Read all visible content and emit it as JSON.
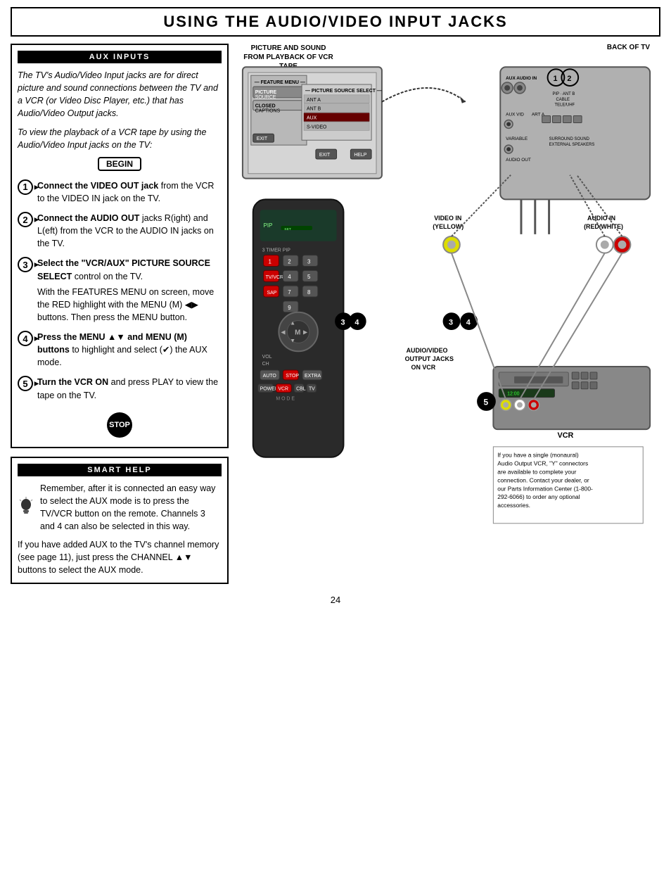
{
  "header": {
    "title": "Using the Audio/Video Input Jacks"
  },
  "left": {
    "aux_inputs_title": "AUX INPUTS",
    "intro": "The TV's Audio/Video Input jacks are for direct picture and sound connections between the TV and a VCR (or Video Disc Player, etc.) that has Audio/Video Output jacks.",
    "intro2": "To view the playback of a VCR tape by using the Audio/Video Input jacks on the TV:",
    "begin_label": "BEGIN",
    "steps": [
      {
        "num": "1",
        "text_bold": "Connect the VIDEO OUT jack",
        "text_rest": " from the VCR to the VIDEO IN jack on the TV."
      },
      {
        "num": "2",
        "text_bold": "Connect the AUDIO OUT",
        "text_rest": " jacks R(ight) and L(eft) from the VCR to the AUDIO IN jacks on the TV."
      },
      {
        "num": "3",
        "text_bold": "Select the \"VCR/AUX\" PICTURE SOURCE SELECT",
        "text_rest": " control on the TV.",
        "extra": "With the FEATURES MENU on screen, move the RED highlight with the MENU (M) ◀▶ buttons. Then press the MENU button."
      },
      {
        "num": "4",
        "text_bold": "Press the MENU ▲▼ and MENU (M) buttons",
        "text_rest": " to highlight and select (✔) the AUX mode."
      },
      {
        "num": "5",
        "text_bold": "Turn the VCR ON",
        "text_rest": " and press PLAY to view the tape  on the TV."
      }
    ],
    "stop_label": "STOP"
  },
  "smart_help": {
    "title": "SMART HELP",
    "text1": "Remember, after it is connected an easy way to select the AUX mode is to press the TV/VCR button on the remote. Channels 3 and 4 can also be selected in this way.",
    "text2": "If you have added AUX  to the TV's channel memory (see page 11), just press the CHANNEL ▲▼ buttons to select the AUX mode."
  },
  "diagram": {
    "label_playback": "PICTURE AND SOUND FROM PLAYBACK OF VCR TAPE",
    "label_back_tv": "BACK OF TV",
    "video_in_label": "VIDEO IN\n(YELLOW)",
    "audio_in_label": "AUDIO IN\n(RED/WHITE)",
    "av_output_label": "AUDIO/VIDEO OUTPUT JACKS ON VCR",
    "vcr_label": "VCR",
    "note_text": "If you have a single (monaural) Audio Output VCR, \"Y\" connectors are available to complete your connection. Contact your dealer, or our Parts Information Center (1-800-292-6066) to order any optional accessories.",
    "menu_items": [
      "PICTURE SOURCE",
      "CLOSED CAPTIONS"
    ],
    "source_items": [
      "ANT A",
      "ANT B",
      "AUX",
      "S-VIDEO"
    ],
    "exit_label": "EXIT",
    "help_label": "HELP"
  },
  "page_number": "24"
}
